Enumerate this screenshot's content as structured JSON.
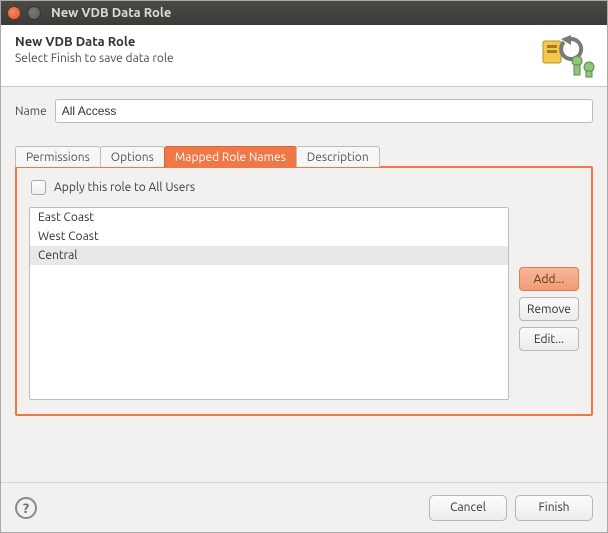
{
  "window": {
    "title": "New VDB Data Role"
  },
  "header": {
    "title": "New VDB Data Role",
    "subtitle": "Select Finish to save data role"
  },
  "form": {
    "name_label": "Name",
    "name_value": "All Access"
  },
  "tabs": {
    "permissions": "Permissions",
    "options": "Options",
    "mapped": "Mapped Role Names",
    "description": "Description"
  },
  "checkbox": {
    "label": "Apply this role to All Users"
  },
  "roles": {
    "items": [
      "East Coast",
      "West Coast",
      "Central"
    ],
    "selected_index": 2,
    "buttons": {
      "add": "Add...",
      "remove": "Remove",
      "edit": "Edit..."
    }
  },
  "footer": {
    "help": "?",
    "cancel": "Cancel",
    "finish": "Finish"
  },
  "colors": {
    "accent": "#f07746"
  }
}
